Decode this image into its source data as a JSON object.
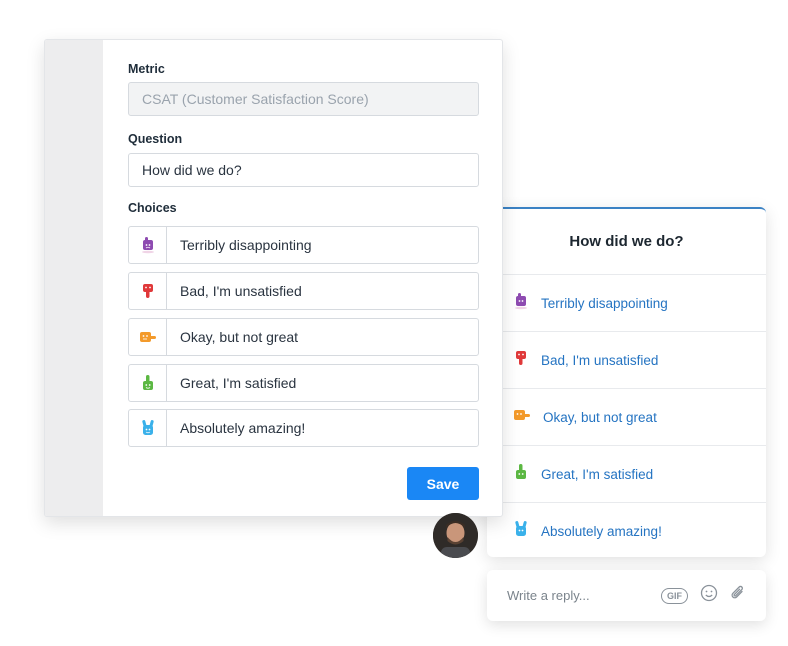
{
  "editor": {
    "metric_label": "Metric",
    "metric_value": "CSAT (Customer Satisfaction Score)",
    "question_label": "Question",
    "question_value": "How did we do?",
    "choices_label": "Choices",
    "choices": [
      {
        "label": "Terribly disappointing",
        "icon": "purple-sad-hand-icon"
      },
      {
        "label": "Bad, I'm unsatisfied",
        "icon": "red-thumbs-down-icon"
      },
      {
        "label": "Okay, but not great",
        "icon": "orange-hand-icon"
      },
      {
        "label": "Great, I'm satisfied",
        "icon": "green-thumbs-up-icon"
      },
      {
        "label": "Absolutely amazing!",
        "icon": "blue-rock-hand-icon"
      }
    ],
    "save_label": "Save"
  },
  "preview": {
    "question": "How did we do?",
    "options": [
      {
        "label": "Terribly disappointing"
      },
      {
        "label": "Bad, I'm unsatisfied"
      },
      {
        "label": "Okay, but not great"
      },
      {
        "label": "Great, I'm satisfied"
      },
      {
        "label": "Absolutely amazing!"
      }
    ]
  },
  "reply": {
    "placeholder": "Write a reply...",
    "gif_label": "GIF"
  },
  "colors": {
    "accent": "#1a87f5",
    "link": "#2574c2",
    "purple": "#8e4bb1",
    "red": "#e0393a",
    "orange": "#f39a2b",
    "green": "#5cb843",
    "blue": "#3ab1ea"
  }
}
